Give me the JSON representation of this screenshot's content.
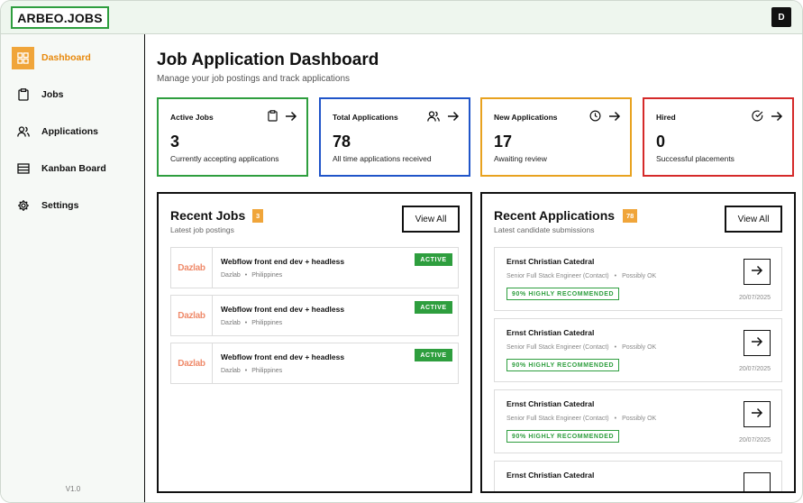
{
  "app": {
    "logo": "ARBEO.JOBS",
    "user_initial": "D",
    "version": "V1.0"
  },
  "sidebar": {
    "items": [
      {
        "label": "Dashboard",
        "icon": "grid-icon",
        "active": true
      },
      {
        "label": "Jobs",
        "icon": "clipboard-icon"
      },
      {
        "label": "Applications",
        "icon": "users-icon"
      },
      {
        "label": "Kanban Board",
        "icon": "kanban-icon"
      },
      {
        "label": "Settings",
        "icon": "gear-icon"
      }
    ]
  },
  "header": {
    "title": "Job Application Dashboard",
    "subtitle": "Manage your job postings and track applications"
  },
  "stats": [
    {
      "label": "Active Jobs",
      "value": "3",
      "desc": "Currently accepting applications",
      "color": "#2e9e3e",
      "icon": "clipboard-icon"
    },
    {
      "label": "Total Applications",
      "value": "78",
      "desc": "All time applications received",
      "color": "#2055c9",
      "icon": "users-icon"
    },
    {
      "label": "New Applications",
      "value": "17",
      "desc": "Awaiting review",
      "color": "#e8a21f",
      "icon": "clock-icon"
    },
    {
      "label": "Hired",
      "value": "0",
      "desc": "Successful placements",
      "color": "#d52a2a",
      "icon": "check-circle-icon"
    }
  ],
  "recent_jobs": {
    "title": "Recent Jobs",
    "count": "3",
    "subtitle": "Latest job postings",
    "view_all": "View All",
    "items": [
      {
        "logo": "Dazlab",
        "title": "Webflow front end dev + headless",
        "company": "Dazlab",
        "location": "Philippines",
        "status": "ACTIVE"
      },
      {
        "logo": "Dazlab",
        "title": "Webflow front end dev + headless",
        "company": "Dazlab",
        "location": "Philippines",
        "status": "ACTIVE"
      },
      {
        "logo": "Dazlab",
        "title": "Webflow front end dev + headless",
        "company": "Dazlab",
        "location": "Philippines",
        "status": "ACTIVE"
      }
    ]
  },
  "recent_applications": {
    "title": "Recent Applications",
    "count": "78",
    "subtitle": "Latest candidate submissions",
    "view_all": "View All",
    "items": [
      {
        "name": "Ernst Christian Catedral",
        "role": "Senior Full Stack Engineer (Contact)",
        "fit": "Possibly OK",
        "badge": "90% HIGHLY RECOMMENDED",
        "date": "20/07/2025"
      },
      {
        "name": "Ernst Christian Catedral",
        "role": "Senior Full Stack Engineer (Contact)",
        "fit": "Possibly OK",
        "badge": "90% HIGHLY RECOMMENDED",
        "date": "20/07/2025"
      },
      {
        "name": "Ernst Christian Catedral",
        "role": "Senior Full Stack Engineer (Contact)",
        "fit": "Possibly OK",
        "badge": "90% HIGHLY RECOMMENDED",
        "date": "20/07/2025"
      },
      {
        "name": "Ernst Christian Catedral",
        "role": "",
        "fit": "",
        "badge": "",
        "date": ""
      }
    ]
  },
  "separator": "•"
}
